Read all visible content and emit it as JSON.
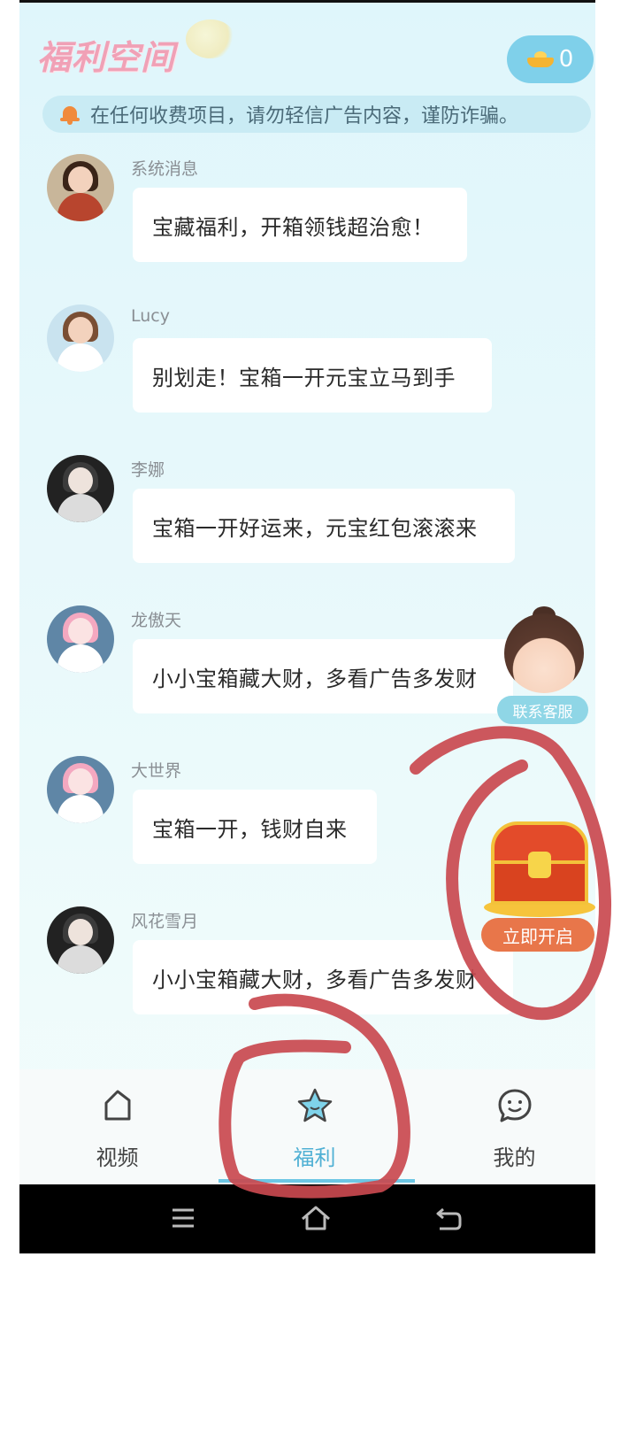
{
  "header": {
    "title": "福利空间",
    "coin_count": "0"
  },
  "notice": {
    "text": "在任何收费项目，请勿轻信广告内容，谨防诈骗。"
  },
  "messages": [
    {
      "sender": "系统消息",
      "text": "宝藏福利，开箱领钱超治愈！"
    },
    {
      "sender": "Lucy",
      "text": "别划走！宝箱一开元宝立马到手"
    },
    {
      "sender": "李娜",
      "text": "宝箱一开好运来，元宝红包滚滚来"
    },
    {
      "sender": "龙傲天",
      "text": "小小宝箱藏大财，多看广告多发财"
    },
    {
      "sender": "大世界",
      "text": "宝箱一开，钱财自来"
    },
    {
      "sender": "风花雪月",
      "text": "小小宝箱藏大财，多看广告多发财"
    }
  ],
  "customer_service": {
    "label": "联系客服"
  },
  "chest": {
    "button_label": "立即开启"
  },
  "tabs": [
    {
      "label": "视频",
      "icon": "home-icon",
      "active": false
    },
    {
      "label": "福利",
      "icon": "star-icon",
      "active": true
    },
    {
      "label": "我的",
      "icon": "smile-icon",
      "active": false
    }
  ],
  "system_nav": {
    "menu": "menu-icon",
    "home": "home-outline-icon",
    "back": "back-icon"
  },
  "colors": {
    "accent": "#4fb0d4",
    "title_pink": "#f0a1b6",
    "annotation_red": "#c9494f",
    "open_button": "#e8764a"
  }
}
